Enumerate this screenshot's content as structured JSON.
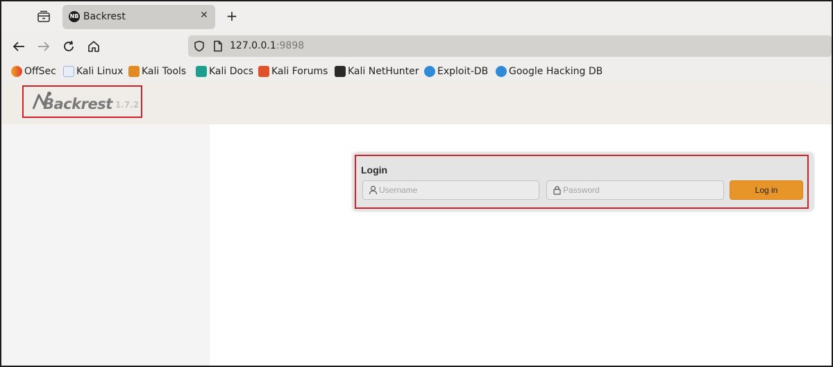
{
  "browser": {
    "tab": {
      "title": "Backrest",
      "favicon_text": "NB"
    },
    "url": {
      "host": "127.0.0.1",
      "port": ":9898"
    },
    "icons": [
      "tab-overview-icon",
      "close-icon",
      "plus-icon",
      "back-arrow-icon",
      "forward-arrow-icon",
      "reload-icon",
      "home-icon",
      "shield-icon",
      "page-icon"
    ],
    "bookmarks": [
      {
        "label": "OffSec",
        "color": "#e8602a"
      },
      {
        "label": "Kali Linux",
        "color": "#3a7bd5"
      },
      {
        "label": "Kali Tools",
        "color": "#d9731f"
      },
      {
        "label": "Kali Docs",
        "color": "#1d9e8e"
      },
      {
        "label": "Kali Forums",
        "color": "#e0532a"
      },
      {
        "label": "Kali NetHunter",
        "color": "#222222"
      },
      {
        "label": "Exploit-DB",
        "color": "#2f8ad8"
      },
      {
        "label": "Google Hacking DB",
        "color": "#2f8ad8"
      }
    ]
  },
  "app": {
    "logo_text": "Backrest",
    "version": "1.7.2",
    "login": {
      "title": "Login",
      "username_placeholder": "Username",
      "password_placeholder": "Password",
      "submit_label": "Log in"
    },
    "colors": {
      "accent": "#e79528",
      "highlight": "#d0202a"
    }
  }
}
